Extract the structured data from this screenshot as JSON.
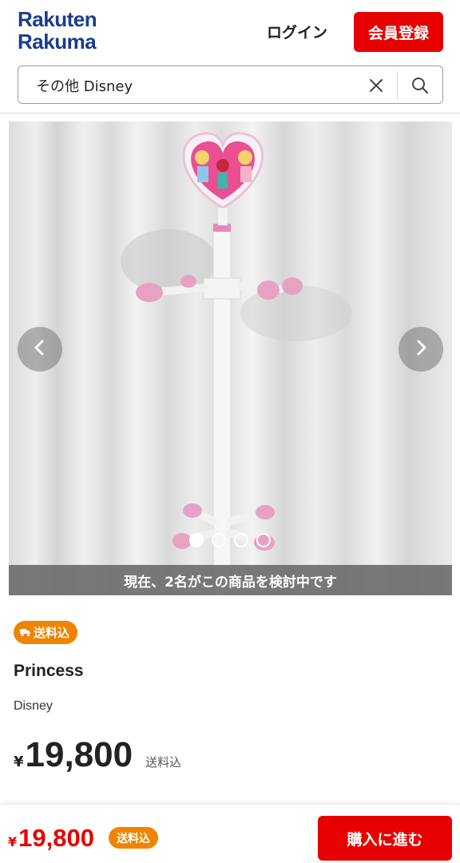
{
  "header": {
    "logo_line1": "Rakuten",
    "logo_line2": "Rakuma",
    "login_label": "ログイン",
    "signup_label": "会員登録",
    "brand_color": "#e60000",
    "logo_color": "#1c3b8f"
  },
  "search": {
    "value": "その他 Disney",
    "clear_icon": "close-icon",
    "search_icon": "search-icon"
  },
  "carousel": {
    "prev_icon": "chevron-left-icon",
    "next_icon": "chevron-right-icon",
    "image_count": 4,
    "active_index": 0,
    "viewers_text": "現在、2名がこの商品を検討中です"
  },
  "product": {
    "shipping_badge": "送料込",
    "shipping_icon": "truck-icon",
    "title": "Princess",
    "brand": "Disney",
    "price_symbol": "¥",
    "price": "19,800",
    "price_note": "送料込"
  },
  "bottom_bar": {
    "price_symbol": "¥",
    "price": "19,800",
    "shipping_badge": "送料込",
    "buy_label": "購入に進む",
    "badge_color": "#f08300"
  }
}
